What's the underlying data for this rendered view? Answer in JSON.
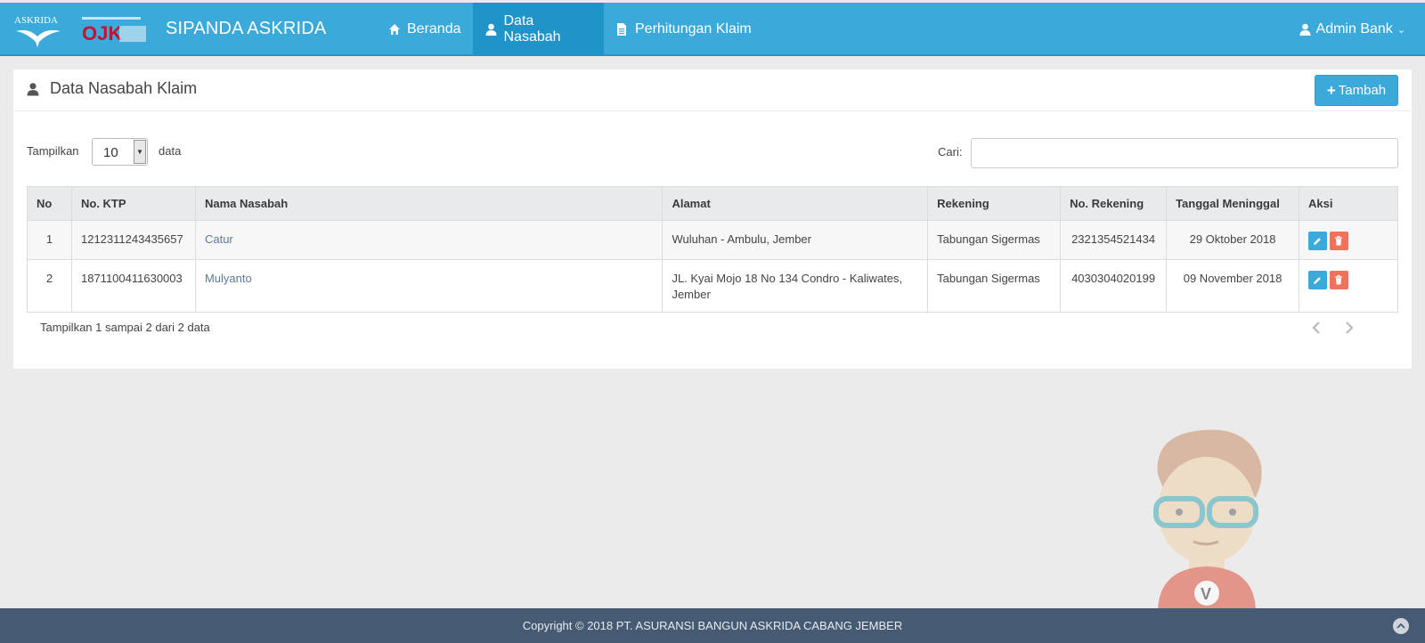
{
  "navbar": {
    "brand": "SIPANDA ASKRIDA",
    "logo_askrida_text": "ASKRIDA",
    "logo_ojk_text": "OJK",
    "items": [
      {
        "label": "Beranda",
        "icon": "home-icon"
      },
      {
        "label": "Data Nasabah",
        "icon": "user-icon"
      },
      {
        "label": "Perhitungan Klaim",
        "icon": "file-icon"
      }
    ],
    "user": "Admin Bank",
    "accent": "#3ba9d9",
    "active_bg": "#1f94c9"
  },
  "panel": {
    "title": "Data Nasabah Klaim",
    "add_button": "Tambah"
  },
  "controls": {
    "length_label": "Tampilkan",
    "length_value": "10",
    "length_suffix": "data",
    "search_label": "Cari:",
    "search_value": ""
  },
  "table": {
    "headers": [
      "No",
      "No. KTP",
      "Nama Nasabah",
      "Alamat",
      "Rekening",
      "No. Rekening",
      "Tanggal Meninggal",
      "Aksi"
    ],
    "rows": [
      {
        "no": "1",
        "ktp": "1212311243435657",
        "nama": "Catur",
        "alamat": "Wuluhan - Ambulu, Jember",
        "rekening": "Tabungan Sigermas",
        "no_rekening": "2321354521434",
        "tanggal": "29 Oktober 2018"
      },
      {
        "no": "2",
        "ktp": "1871100411630003",
        "nama": "Mulyanto",
        "alamat": "JL. Kyai Mojo 18 No 134 Condro - Kaliwates, Jember",
        "rekening": "Tabungan Sigermas",
        "no_rekening": "4030304020199",
        "tanggal": "09 November 2018"
      }
    ]
  },
  "info": "Tampilkan 1 sampai 2 dari 2 data",
  "footer": "Copyright © 2018 PT. ASURANSI BANGUN ASKRIDA CABANG JEMBER",
  "colors": {
    "edit": "#3ba9d9",
    "delete": "#f0725c",
    "footer": "#465a73"
  }
}
